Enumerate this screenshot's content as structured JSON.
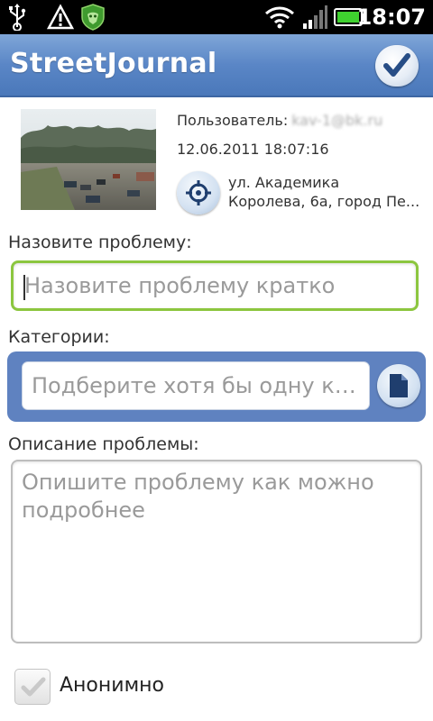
{
  "status_bar": {
    "time": "18:07",
    "icons": [
      "usb-icon",
      "warning-icon",
      "antivirus-shield-icon",
      "wifi-icon",
      "signal-icon",
      "battery-icon"
    ]
  },
  "header": {
    "title": "StreetJournal",
    "done_icon": "checkmark-icon"
  },
  "meta": {
    "user_label": "Пользователь:",
    "user_email": "kav-1@bk.ru",
    "datetime": "12.06.2011 18:07:16",
    "address_line1": "ул. Академика",
    "address_line2": "Королева, 6а, город Пе...",
    "locate_icon": "crosshair-icon"
  },
  "form": {
    "name_label": "Назовите проблему:",
    "name_placeholder": "Назовите проблему кратко",
    "categories_label": "Категории:",
    "categories_placeholder": "Подберите хотя бы одну ка...",
    "categories_button_icon": "document-icon",
    "description_label": "Описание проблемы:",
    "description_placeholder": "Опишите проблему как можно подробнее",
    "anonymous_label": "Анонимно",
    "anonymous_checked": true
  },
  "colors": {
    "header_blue": "#5a86c6",
    "category_panel": "#5f82c0",
    "focus_green": "#8cc63f"
  }
}
